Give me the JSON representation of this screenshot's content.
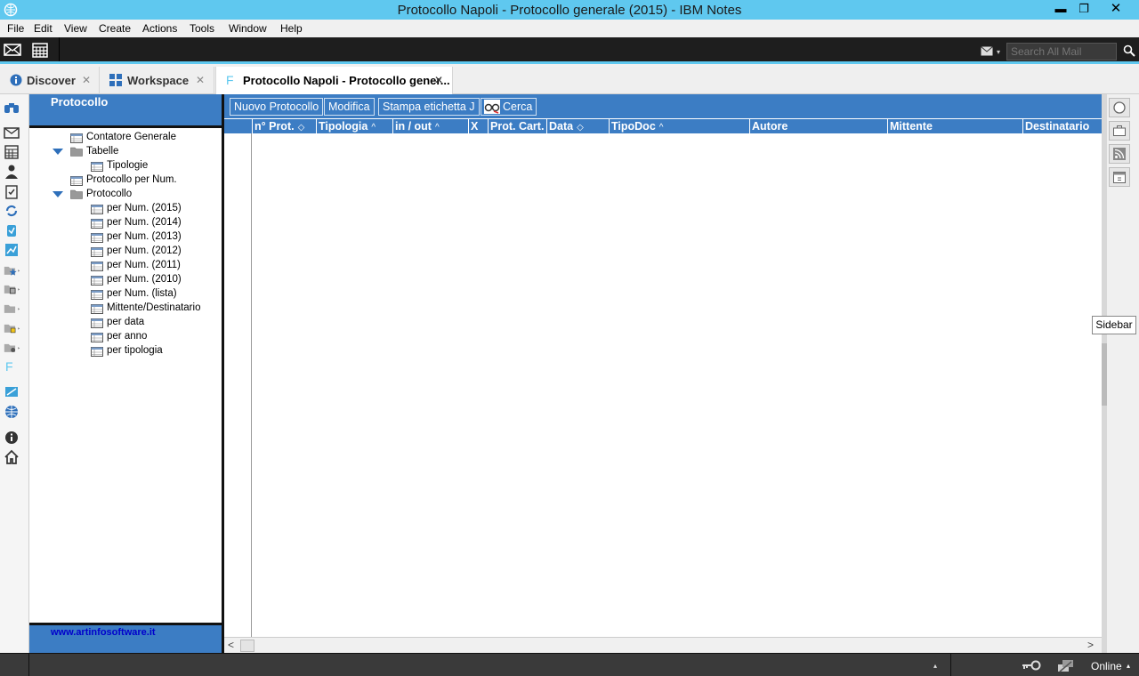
{
  "window": {
    "title": "Protocollo Napoli - Protocollo generale (2015) - IBM Notes",
    "min": "▬",
    "max": "❐",
    "close": "✕"
  },
  "menu": [
    "File",
    "Edit",
    "View",
    "Create",
    "Actions",
    "Tools",
    "Window",
    "Help"
  ],
  "toolbar": {
    "search_placeholder": "Search All Mail",
    "search_scope_caret": "▾"
  },
  "tabs": [
    {
      "label": "Discover",
      "close": "✕"
    },
    {
      "label": "Workspace",
      "close": "✕"
    },
    {
      "label": "Protocollo Napoli - Protocollo gener...",
      "close": "✕",
      "icon": "F"
    }
  ],
  "navigator": {
    "title": "Protocollo",
    "items": [
      {
        "label": "Contatore Generale",
        "type": "view"
      },
      {
        "label": "Tabelle",
        "type": "folder"
      },
      {
        "label": "Tipologie",
        "type": "view"
      },
      {
        "label": "Protocollo per Num.",
        "type": "view"
      },
      {
        "label": "Protocollo",
        "type": "folder"
      },
      {
        "label": "per Num. (2015)",
        "type": "view"
      },
      {
        "label": "per Num. (2014)",
        "type": "view"
      },
      {
        "label": "per Num. (2013)",
        "type": "view"
      },
      {
        "label": "per Num. (2012)",
        "type": "view"
      },
      {
        "label": "per Num. (2011)",
        "type": "view"
      },
      {
        "label": "per Num. (2010)",
        "type": "view"
      },
      {
        "label": "per Num. (lista)",
        "type": "view"
      },
      {
        "label": "Mittente/Destinatario",
        "type": "view"
      },
      {
        "label": "per data",
        "type": "view"
      },
      {
        "label": "per anno",
        "type": "view"
      },
      {
        "label": "per tipologia",
        "type": "view"
      }
    ],
    "footer_link": "www.artinfosoftware.it"
  },
  "actions": [
    "Nuovo Protocollo",
    "Modifica",
    "Stampa etichetta J",
    "Cerca"
  ],
  "columns": [
    {
      "label": "n° Prot.",
      "sort": "◇"
    },
    {
      "label": "Tipologia",
      "sort": "^"
    },
    {
      "label": "in / out",
      "sort": "^"
    },
    {
      "label": "X",
      "sort": ""
    },
    {
      "label": "Prot. Cart.",
      "sort": ""
    },
    {
      "label": "Data",
      "sort": "◇"
    },
    {
      "label": "TipoDoc",
      "sort": "^"
    },
    {
      "label": "Autore",
      "sort": ""
    },
    {
      "label": "Mittente",
      "sort": ""
    },
    {
      "label": "Destinatario",
      "sort": ""
    }
  ],
  "scroll": {
    "left": "<",
    "right": ">"
  },
  "sidebar": {
    "tooltip": "Sidebar"
  },
  "status": {
    "online": "Online",
    "caret": "▴"
  },
  "colors": {
    "accent": "#5fc8ef",
    "view_blue": "#3c7dc4",
    "link": "#0000cc"
  }
}
